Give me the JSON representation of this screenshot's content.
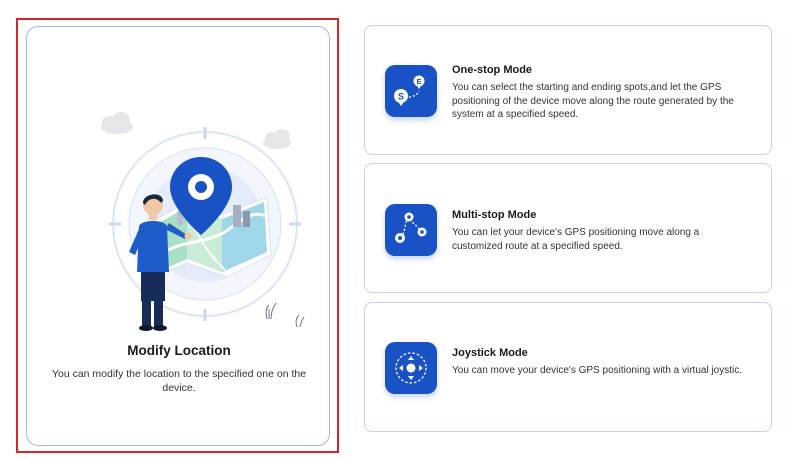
{
  "modify_location": {
    "title": "Modify Location",
    "description": "You can modify the location to the specified one on the device."
  },
  "modes": [
    {
      "title": "One-stop Mode",
      "description": "You can select the starting and ending spots,and let the GPS positioning of the device move along the route generated by the system at a specified speed.",
      "icon": "one-stop-route-icon",
      "icon_start_letter": "S",
      "icon_end_letter": "E"
    },
    {
      "title": "Multi-stop Mode",
      "description": "You can let your device's GPS positioning move along a customized route at a specified speed.",
      "icon": "multi-stop-route-icon"
    },
    {
      "title": "Joystick Mode",
      "description": "You can move your device's GPS positioning with a virtual joystic.",
      "icon": "joystick-icon"
    }
  ],
  "colors": {
    "accent": "#1852c4",
    "highlight": "#d9232d",
    "card_border": "#9db8ea"
  }
}
